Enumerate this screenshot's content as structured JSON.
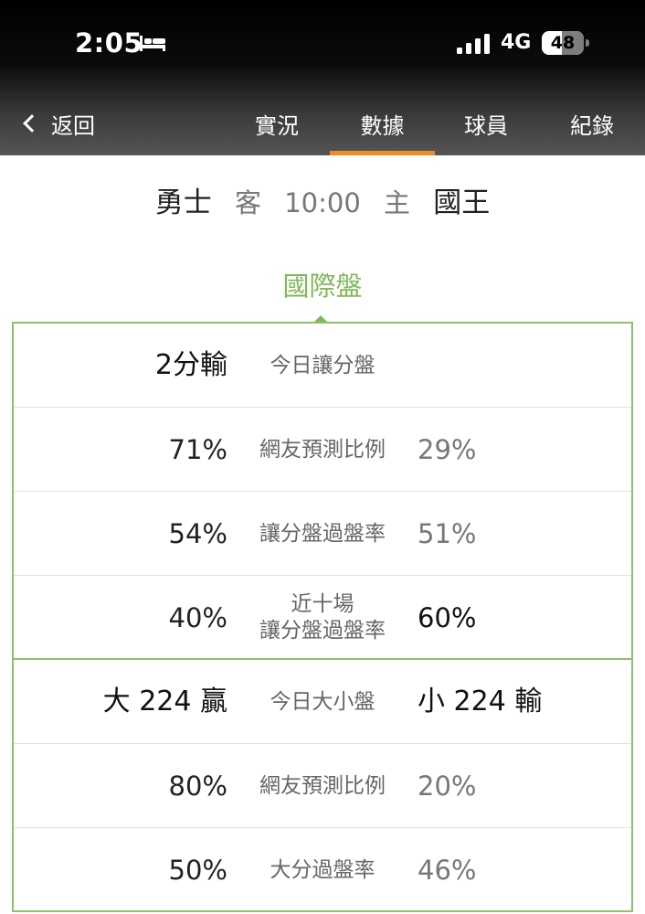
{
  "status_bar": {
    "time": "2:05",
    "network": "4G",
    "battery": "48",
    "battery_level": 0.48,
    "icons": [
      "bed-icon",
      "signal-icon",
      "battery-icon"
    ]
  },
  "nav": {
    "back_label": "返回",
    "tabs": [
      {
        "label": "實況",
        "active": false
      },
      {
        "label": "數據",
        "active": true
      },
      {
        "label": "球員",
        "active": false
      },
      {
        "label": "紀錄",
        "active": false
      }
    ],
    "accent_color": "#f08c25"
  },
  "matchup": {
    "away_team": "勇士",
    "away_tag": "客",
    "time": "10:00",
    "home_tag": "主",
    "home_team": "國王"
  },
  "section": {
    "title": "國際盤",
    "color": "#7fb85a"
  },
  "spread": [
    {
      "left": "2分輸",
      "label": "今日讓分盤",
      "right": ""
    },
    {
      "left": "71%",
      "label": "網友預測比例",
      "right": "29%"
    },
    {
      "left": "54%",
      "label": "讓分盤過盤率",
      "right": "51%"
    },
    {
      "left": "40%",
      "label_line1": "近十場",
      "label_line2": "讓分盤過盤率",
      "right": "60%"
    }
  ],
  "total": [
    {
      "left": "大 224 贏",
      "label": "今日大小盤",
      "right": "小 224 輸"
    },
    {
      "left": "80%",
      "label": "網友預測比例",
      "right": "20%"
    },
    {
      "left": "50%",
      "label": "大分過盤率",
      "right": "46%"
    }
  ]
}
